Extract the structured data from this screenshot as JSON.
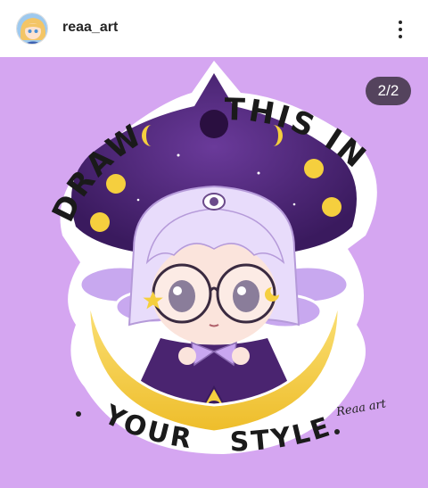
{
  "header": {
    "username": "reaa_art",
    "avatar_icon": "avatar-icon",
    "more_icon": "more-options-icon"
  },
  "post": {
    "counter": "2/2",
    "sticker_text": {
      "top_left": "DRAW",
      "top_right": "THIS IN",
      "bottom_left": "YOUR",
      "bottom_right": "STYLE"
    },
    "signature": "Reaa art",
    "colors": {
      "background": "#d5a6f1",
      "hat": "#4a2470",
      "moon": "#f5cf3e",
      "hair": "#e8dcfb"
    }
  }
}
